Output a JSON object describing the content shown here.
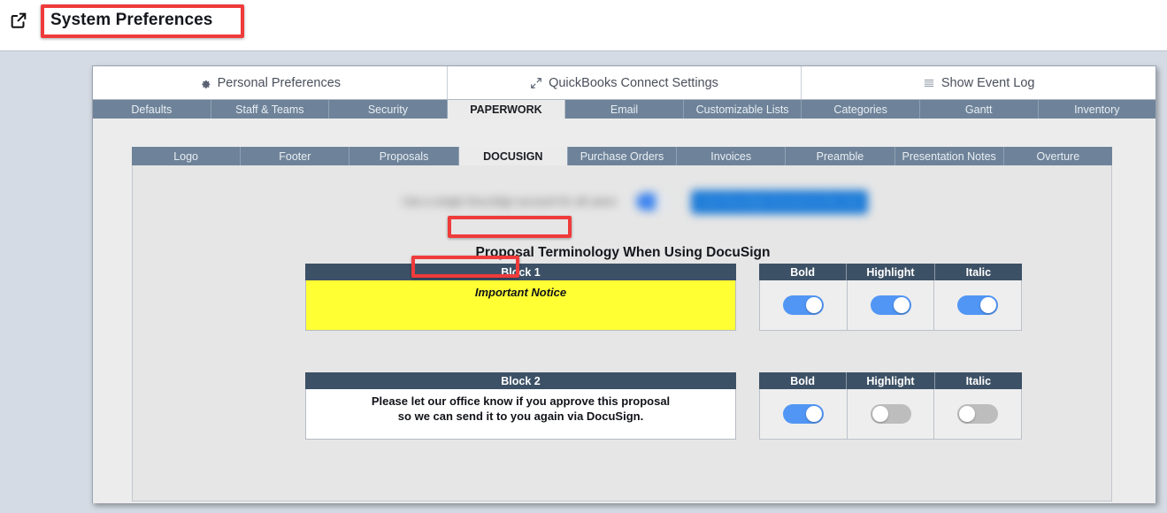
{
  "window": {
    "title": "System Preferences",
    "external_link_icon": "external-link-icon"
  },
  "top_buttons": [
    {
      "label": "Personal Preferences",
      "icon": "gear-icon"
    },
    {
      "label": "QuickBooks Connect Settings",
      "icon": "expand-arrows-icon"
    },
    {
      "label": "Show Event Log",
      "icon": "list-lines-icon"
    }
  ],
  "tabs_level2": [
    {
      "label": "Defaults",
      "active": false
    },
    {
      "label": "Staff & Teams",
      "active": false
    },
    {
      "label": "Security",
      "active": false
    },
    {
      "label": "PAPERWORK",
      "active": true
    },
    {
      "label": "Email",
      "active": false
    },
    {
      "label": "Customizable Lists",
      "active": false
    },
    {
      "label": "Categories",
      "active": false
    },
    {
      "label": "Gantt",
      "active": false
    },
    {
      "label": "Inventory",
      "active": false
    }
  ],
  "tabs_level3": [
    {
      "label": "Logo",
      "active": false
    },
    {
      "label": "Footer",
      "active": false
    },
    {
      "label": "Proposals",
      "active": false
    },
    {
      "label": "DOCUSIGN",
      "active": true
    },
    {
      "label": "Purchase Orders",
      "active": false
    },
    {
      "label": "Invoices",
      "active": false
    },
    {
      "label": "Preamble",
      "active": false
    },
    {
      "label": "Presentation Notes",
      "active": false
    },
    {
      "label": "Overture",
      "active": false
    }
  ],
  "redacted_row": {
    "label": "Use a single DocuSign account for all users",
    "button_label": "Link DocuSign Account to this Job",
    "blurred": true
  },
  "section": {
    "heading": "Proposal Terminology When Using DocuSign"
  },
  "toggle_columns": [
    "Bold",
    "Highlight",
    "Italic"
  ],
  "blocks": [
    {
      "header": "Block 1",
      "text": "Important Notice",
      "bold": true,
      "highlight": true,
      "italic": true
    },
    {
      "header": "Block 2",
      "text": "Please let our office know if you approve this proposal\nso we can send it to you again via DocuSign.",
      "bold": true,
      "highlight": false,
      "italic": false
    }
  ],
  "annotations": [
    {
      "target": "page-title",
      "color": "#ef3b3b"
    },
    {
      "target": "tab-paperwork",
      "color": "#ef3b3b"
    },
    {
      "target": "tab-docusign",
      "color": "#ef3b3b"
    }
  ],
  "colors": {
    "page_background": "#d5dbe4",
    "tab_bar": "#6e8399",
    "block_header": "#3d5166",
    "highlight_yellow": "#ffff33",
    "toggle_on": "#5196f5",
    "toggle_off": "#bdbdbd",
    "annotation_red": "#ef3b3b"
  }
}
